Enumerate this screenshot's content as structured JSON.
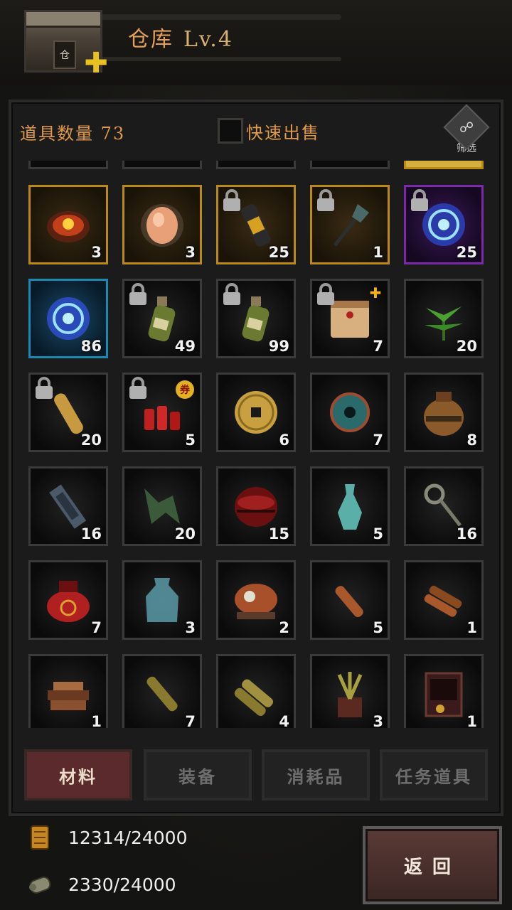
{
  "header": {
    "title": "仓库",
    "level": "Lv.4",
    "building_sign": "仓"
  },
  "toolbar": {
    "item_count_label": "道具数量 73",
    "quick_sell_label": "快速出售",
    "filter_label": "筛选"
  },
  "items": [
    {
      "icon": "ore-chunk-icon",
      "count": "3",
      "frame": "gold",
      "locked": false
    },
    {
      "icon": "glowing-egg-icon",
      "count": "3",
      "frame": "gold",
      "locked": false
    },
    {
      "icon": "sos-bottle-icon",
      "count": "25",
      "frame": "gold",
      "locked": true
    },
    {
      "icon": "shovel-icon",
      "count": "1",
      "frame": "gold",
      "locked": true
    },
    {
      "icon": "purple-vortex-orb-icon",
      "count": "25",
      "frame": "purple",
      "locked": true
    },
    {
      "icon": "blue-vortex-orb-icon",
      "count": "86",
      "frame": "blue",
      "locked": false
    },
    {
      "icon": "potion-bottle-icon",
      "count": "49",
      "frame": "normal",
      "locked": true
    },
    {
      "icon": "potion-bottle-icon",
      "count": "99",
      "frame": "normal",
      "locked": true
    },
    {
      "icon": "scroll-map-icon",
      "count": "7",
      "frame": "normal",
      "locked": true,
      "puzzle": true
    },
    {
      "icon": "herb-leaf-icon",
      "count": "20",
      "frame": "normal",
      "locked": false
    },
    {
      "icon": "wheat-bundle-icon",
      "count": "20",
      "frame": "normal",
      "locked": true
    },
    {
      "icon": "firecracker-icon",
      "count": "5",
      "frame": "normal",
      "locked": true,
      "badge": "券"
    },
    {
      "icon": "ancient-coin-icon",
      "count": "6",
      "frame": "normal",
      "locked": false
    },
    {
      "icon": "jade-disc-icon",
      "count": "7",
      "frame": "normal",
      "locked": false
    },
    {
      "icon": "clay-jar-icon",
      "count": "8",
      "frame": "normal",
      "locked": false
    },
    {
      "icon": "bronze-plaque-icon",
      "count": "16",
      "frame": "normal",
      "locked": false
    },
    {
      "icon": "bronze-hook-icon",
      "count": "20",
      "frame": "normal",
      "locked": false
    },
    {
      "icon": "lacquer-box-icon",
      "count": "15",
      "frame": "normal",
      "locked": false
    },
    {
      "icon": "celadon-vase-icon",
      "count": "5",
      "frame": "normal",
      "locked": false
    },
    {
      "icon": "bronze-key-icon",
      "count": "16",
      "frame": "normal",
      "locked": false
    },
    {
      "icon": "lacquer-pot-icon",
      "count": "7",
      "frame": "normal",
      "locked": false
    },
    {
      "icon": "glass-jar-icon",
      "count": "3",
      "frame": "normal",
      "locked": false
    },
    {
      "icon": "rock-sculpture-icon",
      "count": "2",
      "frame": "normal",
      "locked": false
    },
    {
      "icon": "scroll-single-icon",
      "count": "5",
      "frame": "normal",
      "locked": false
    },
    {
      "icon": "scroll-pair-icon",
      "count": "1",
      "frame": "normal",
      "locked": false
    },
    {
      "icon": "book-pile-icon",
      "count": "1",
      "frame": "normal",
      "locked": false
    },
    {
      "icon": "bamboo-scroll-icon",
      "count": "7",
      "frame": "normal",
      "locked": false
    },
    {
      "icon": "bamboo-bundle-icon",
      "count": "4",
      "frame": "normal",
      "locked": false
    },
    {
      "icon": "potted-plant-icon",
      "count": "3",
      "frame": "normal",
      "locked": false
    },
    {
      "icon": "treasure-cabinet-icon",
      "count": "1",
      "frame": "normal",
      "locked": false
    }
  ],
  "tabs": [
    {
      "label": "材料",
      "active": true
    },
    {
      "label": "装备",
      "active": false
    },
    {
      "label": "消耗品",
      "active": false
    },
    {
      "label": "任务道具",
      "active": false
    }
  ],
  "resources": [
    {
      "icon": "gold-scroll-icon",
      "value": "12314/24000"
    },
    {
      "icon": "silver-scroll-icon",
      "value": "2330/24000"
    }
  ],
  "back_button": {
    "label": "返回"
  },
  "colors": {
    "accent": "#e09a48",
    "gold_frame": "#b98a18",
    "purple_frame": "#7a2aa8",
    "blue_frame": "#1a8ab0",
    "active_tab": "#5a2a2c"
  }
}
